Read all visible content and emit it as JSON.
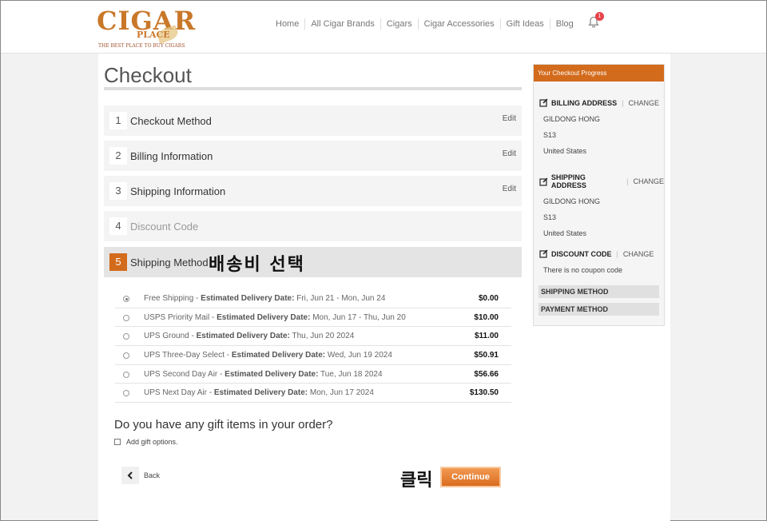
{
  "header": {
    "logo_main": "CIGAR",
    "logo_sub": "PLACE",
    "logo_tagline": "THE BEST PLACE TO BUY CIGARS",
    "nav": [
      "Home",
      "All Cigar Brands",
      "Cigars",
      "Cigar Accessories",
      "Gift Ideas",
      "Blog"
    ],
    "notification_count": "1"
  },
  "checkout": {
    "title": "Checkout",
    "steps": [
      {
        "num": "1",
        "label": "Checkout Method",
        "edit": "Edit"
      },
      {
        "num": "2",
        "label": "Billing Information",
        "edit": "Edit"
      },
      {
        "num": "3",
        "label": "Shipping Information",
        "edit": "Edit"
      },
      {
        "num": "4",
        "label": "Discount Code"
      },
      {
        "num": "5",
        "label": "Shipping Method"
      }
    ],
    "annotation_shipping": "배송비 선택",
    "delivery_prefix": "Estimated Delivery Date:",
    "shipping_options": [
      {
        "name": "Free Shipping",
        "date": "Fri, Jun 21 - Mon, Jun 24",
        "price": "$0.00"
      },
      {
        "name": "USPS Priority Mail",
        "date": "Mon, Jun 17 - Thu, Jun 20",
        "price": "$10.00"
      },
      {
        "name": "UPS Ground",
        "date": "Thu, Jun 20 2024",
        "price": "$11.00"
      },
      {
        "name": "UPS Three-Day Select",
        "date": "Wed, Jun 19 2024",
        "price": "$50.91"
      },
      {
        "name": "UPS Second Day Air",
        "date": "Tue, Jun 18 2024",
        "price": "$56.66"
      },
      {
        "name": "UPS Next Day Air",
        "date": "Mon, Jun 17 2024",
        "price": "$130.50"
      }
    ],
    "selected_option": "Free Shipping",
    "gift_question": "Do you have any gift items in your order?",
    "gift_checkbox_label": "Add gift options.",
    "back_label": "Back",
    "annotation_click": "클릭",
    "continue_label": "Continue"
  },
  "progress": {
    "title": "Your Checkout Progress",
    "billing": {
      "heading": "BILLING ADDRESS",
      "change": "CHANGE",
      "lines": [
        "GILDONG HONG",
        "S13",
        "United States"
      ]
    },
    "shipping": {
      "heading": "SHIPPING ADDRESS",
      "change": "CHANGE",
      "lines": [
        "GILDONG HONG",
        "S13",
        "United States"
      ]
    },
    "discount": {
      "heading": "DISCOUNT CODE",
      "change": "CHANGE",
      "lines": [
        "There is no coupon code"
      ]
    },
    "shipping_method": "SHIPPING METHOD",
    "payment_method": "PAYMENT METHOD"
  },
  "colors": {
    "accent": "#d36b1c",
    "brand": "#c9782a",
    "badge": "#e8434a"
  }
}
